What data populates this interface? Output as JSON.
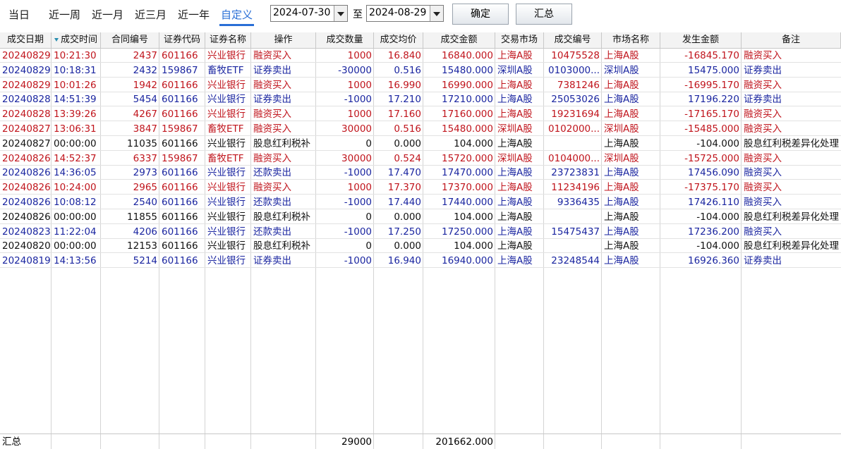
{
  "toolbar": {
    "tabs": [
      "当日",
      "近一周",
      "近一月",
      "近三月",
      "近一年",
      "自定义"
    ],
    "active_tab": "自定义",
    "start_date": "2024-07-30",
    "to_label": "至",
    "end_date": "2024-08-29",
    "confirm_label": "确定",
    "summary_label": "汇总"
  },
  "colors": {
    "buy": "#c0141c",
    "sell": "#1a25a0",
    "neutral": "#111111",
    "accent": "#2a6fd6"
  },
  "table": {
    "headers": [
      "成交日期",
      "成交时间",
      "合同编号",
      "证券代码",
      "证券名称",
      "操作",
      "成交数量",
      "成交均价",
      "成交金额",
      "交易市场",
      "成交编号",
      "市场名称",
      "发生金额",
      "备注"
    ],
    "rows": [
      {
        "type": "buy",
        "cells": [
          "20240829",
          "10:21:30",
          "2437",
          "601166",
          "兴业银行",
          "融资买入",
          "1000",
          "16.840",
          "16840.000",
          "上海A股",
          "10475528",
          "上海A股",
          "-16845.170",
          "融资买入"
        ]
      },
      {
        "type": "sell",
        "cells": [
          "20240829",
          "10:18:31",
          "2432",
          "159867",
          "畜牧ETF",
          "证券卖出",
          "-30000",
          "0.516",
          "15480.000",
          "深圳A股",
          "0103000...",
          "深圳A股",
          "15475.000",
          "证券卖出"
        ]
      },
      {
        "type": "buy",
        "cells": [
          "20240829",
          "10:01:26",
          "1942",
          "601166",
          "兴业银行",
          "融资买入",
          "1000",
          "16.990",
          "16990.000",
          "上海A股",
          "7381246",
          "上海A股",
          "-16995.170",
          "融资买入"
        ]
      },
      {
        "type": "sell",
        "cells": [
          "20240828",
          "14:51:39",
          "5454",
          "601166",
          "兴业银行",
          "证券卖出",
          "-1000",
          "17.210",
          "17210.000",
          "上海A股",
          "25053026",
          "上海A股",
          "17196.220",
          "证券卖出"
        ]
      },
      {
        "type": "buy",
        "cells": [
          "20240828",
          "13:39:26",
          "4267",
          "601166",
          "兴业银行",
          "融资买入",
          "1000",
          "17.160",
          "17160.000",
          "上海A股",
          "19231694",
          "上海A股",
          "-17165.170",
          "融资买入"
        ]
      },
      {
        "type": "buy",
        "cells": [
          "20240827",
          "13:06:31",
          "3847",
          "159867",
          "畜牧ETF",
          "融资买入",
          "30000",
          "0.516",
          "15480.000",
          "深圳A股",
          "0102000...",
          "深圳A股",
          "-15485.000",
          "融资买入"
        ]
      },
      {
        "type": "neutral",
        "cells": [
          "20240827",
          "00:00:00",
          "11035",
          "601166",
          "兴业银行",
          "股息红利税补",
          "0",
          "0.000",
          "104.000",
          "上海A股",
          "",
          "上海A股",
          "-104.000",
          "股息红利税差异化处理"
        ]
      },
      {
        "type": "buy",
        "cells": [
          "20240826",
          "14:52:37",
          "6337",
          "159867",
          "畜牧ETF",
          "融资买入",
          "30000",
          "0.524",
          "15720.000",
          "深圳A股",
          "0104000...",
          "深圳A股",
          "-15725.000",
          "融资买入"
        ]
      },
      {
        "type": "sell",
        "cells": [
          "20240826",
          "14:36:05",
          "2973",
          "601166",
          "兴业银行",
          "还款卖出",
          "-1000",
          "17.470",
          "17470.000",
          "上海A股",
          "23723831",
          "上海A股",
          "17456.090",
          "融资买入"
        ]
      },
      {
        "type": "buy",
        "cells": [
          "20240826",
          "10:24:00",
          "2965",
          "601166",
          "兴业银行",
          "融资买入",
          "1000",
          "17.370",
          "17370.000",
          "上海A股",
          "11234196",
          "上海A股",
          "-17375.170",
          "融资买入"
        ]
      },
      {
        "type": "sell",
        "cells": [
          "20240826",
          "10:08:12",
          "2540",
          "601166",
          "兴业银行",
          "还款卖出",
          "-1000",
          "17.440",
          "17440.000",
          "上海A股",
          "9336435",
          "上海A股",
          "17426.110",
          "融资买入"
        ]
      },
      {
        "type": "neutral",
        "cells": [
          "20240826",
          "00:00:00",
          "11855",
          "601166",
          "兴业银行",
          "股息红利税补",
          "0",
          "0.000",
          "104.000",
          "上海A股",
          "",
          "上海A股",
          "-104.000",
          "股息红利税差异化处理"
        ]
      },
      {
        "type": "sell",
        "cells": [
          "20240823",
          "11:22:04",
          "4206",
          "601166",
          "兴业银行",
          "还款卖出",
          "-1000",
          "17.250",
          "17250.000",
          "上海A股",
          "15475437",
          "上海A股",
          "17236.200",
          "融资买入"
        ]
      },
      {
        "type": "neutral",
        "cells": [
          "20240820",
          "00:00:00",
          "12153",
          "601166",
          "兴业银行",
          "股息红利税补",
          "0",
          "0.000",
          "104.000",
          "上海A股",
          "",
          "上海A股",
          "-104.000",
          "股息红利税差异化处理"
        ]
      },
      {
        "type": "sell",
        "cells": [
          "20240819",
          "14:13:56",
          "5214",
          "601166",
          "兴业银行",
          "证券卖出",
          "-1000",
          "16.940",
          "16940.000",
          "上海A股",
          "23248544",
          "上海A股",
          "16926.360",
          "证券卖出"
        ]
      }
    ],
    "summary": {
      "label": "汇总",
      "quantity": "29000",
      "amount": "201662.000"
    }
  }
}
